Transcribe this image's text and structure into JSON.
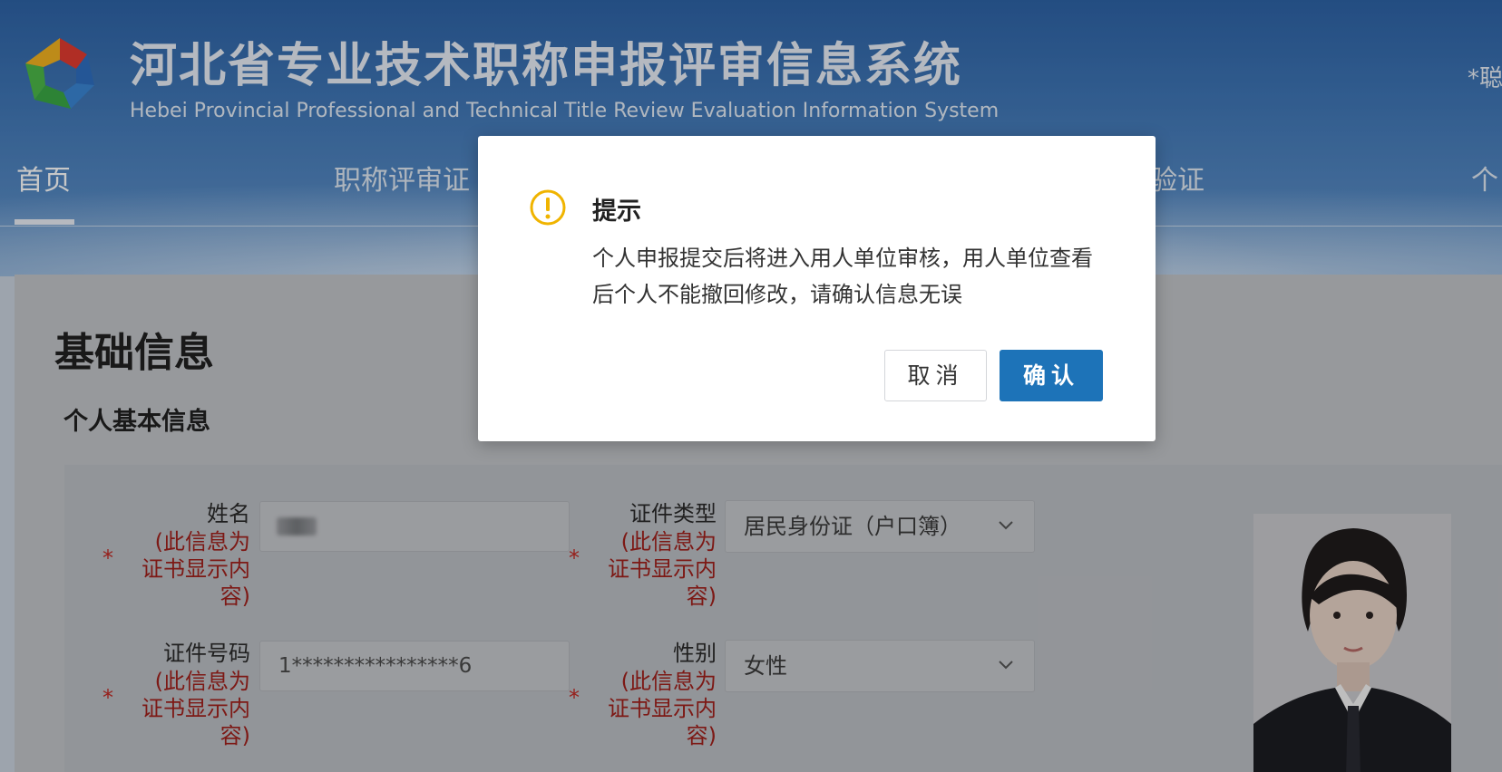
{
  "header": {
    "title_cn": "河北省专业技术职称申报评审信息系统",
    "title_en": "Hebei Provincial Professional and Technical Title Review Evaluation Information System",
    "top_right_text": "*聪"
  },
  "nav": {
    "items": [
      {
        "label": "首页"
      },
      {
        "label": "职称评审证"
      },
      {
        "label": "验证"
      },
      {
        "label": "个"
      }
    ]
  },
  "content": {
    "section_title": "基础信息",
    "sub_title": "个人基本信息",
    "required_star": "*",
    "fields": {
      "name": {
        "label": "姓名",
        "note": "(此信息为证书显示内容)",
        "value": ""
      },
      "id_type": {
        "label": "证件类型",
        "note": "(此信息为证书显示内容)",
        "value": "居民身份证（户口簿）"
      },
      "id_number": {
        "label": "证件号码",
        "note": "(此信息为证书显示内容)",
        "value": "1****************6"
      },
      "gender": {
        "label": "性别",
        "note": "(此信息为证书显示内容)",
        "value": "女性"
      }
    }
  },
  "modal": {
    "title": "提示",
    "message": "个人申报提交后将进入用人单位审核，用人单位查看后个人不能撤回修改，请确认信息无误",
    "cancel_label": "取消",
    "confirm_label": "确认",
    "icon": "warning-circle-icon",
    "accent_color": "#1d73b8",
    "warning_color": "#f0b400"
  }
}
